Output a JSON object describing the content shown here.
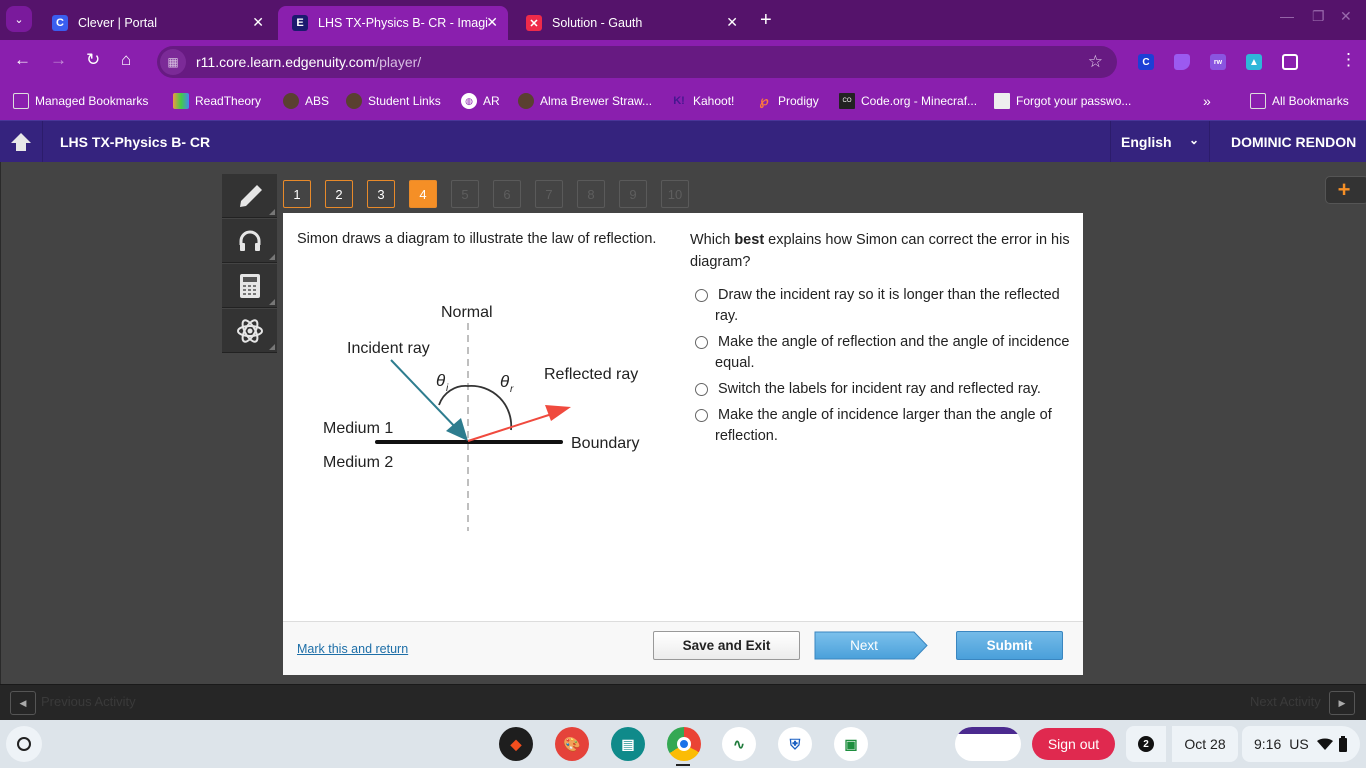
{
  "browser": {
    "tabs": [
      {
        "title": "Clever | Portal",
        "icon": "clever-icon",
        "active": false
      },
      {
        "title": "LHS TX-Physics B- CR - Imagine",
        "icon": "edgenuity-icon",
        "active": true
      },
      {
        "title": "Solution - Gauth",
        "icon": "gauth-icon",
        "active": false
      }
    ],
    "url_host": "r11.core.learn.edgenuity.com",
    "url_path": "/player/",
    "bookmarks": [
      {
        "label": "Managed Bookmarks",
        "icon": "folder-managed-icon"
      },
      {
        "label": "ReadTheory",
        "icon": "readtheory-icon"
      },
      {
        "label": "ABS",
        "icon": "school-seal-icon"
      },
      {
        "label": "Student Links",
        "icon": "school-seal-icon"
      },
      {
        "label": "AR",
        "icon": "globe-icon"
      },
      {
        "label": "Alma Brewer Straw...",
        "icon": "school-seal-icon"
      },
      {
        "label": "Kahoot!",
        "icon": "kahoot-icon"
      },
      {
        "label": "Prodigy",
        "icon": "prodigy-icon"
      },
      {
        "label": "Code.org - Minecraf...",
        "icon": "codeorg-icon"
      },
      {
        "label": "Forgot your passwo...",
        "icon": "page-icon"
      }
    ],
    "all_bookmarks_label": "All Bookmarks"
  },
  "app": {
    "course_title": "LHS TX-Physics B- CR",
    "language": "English",
    "user_name": "DOMINIC RENDON",
    "question_numbers": [
      {
        "n": "1",
        "state": "visited"
      },
      {
        "n": "2",
        "state": "visited"
      },
      {
        "n": "3",
        "state": "visited"
      },
      {
        "n": "4",
        "state": "current"
      },
      {
        "n": "5",
        "state": "locked"
      },
      {
        "n": "6",
        "state": "locked"
      },
      {
        "n": "7",
        "state": "locked"
      },
      {
        "n": "8",
        "state": "locked"
      },
      {
        "n": "9",
        "state": "locked"
      },
      {
        "n": "10",
        "state": "locked"
      }
    ],
    "stem": "Simon draws a diagram to illustrate the law of reflection.",
    "diagram": {
      "normal_label": "Normal",
      "incident_label": "Incident ray",
      "reflected_label": "Reflected ray",
      "medium1_label": "Medium 1",
      "medium2_label": "Medium 2",
      "boundary_label": "Boundary",
      "theta_i": "θ",
      "theta_i_sub": "i",
      "theta_r": "θ",
      "theta_r_sub": "r",
      "incident_color": "#2e7d8f",
      "reflected_color": "#f04a3e"
    },
    "question_pre": "Which ",
    "question_bold": "best",
    "question_post": " explains how Simon can correct the error in his diagram?",
    "options": [
      "Draw the incident ray so it is longer than the reflected ray.",
      "Make the angle of reflection and the angle of incidence equal.",
      "Switch the labels for incident ray and reflected ray.",
      "Make the angle of incidence larger than the angle of reflection."
    ],
    "mark_link": "Mark this and return",
    "save_exit": "Save and Exit",
    "next": "Next",
    "submit": "Submit",
    "prev_activity": "Previous Activity",
    "next_activity": "Next Activity"
  },
  "shelf": {
    "signout": "Sign out",
    "notifications": "2",
    "date": "Oct 28",
    "time": "9:16",
    "locale": "US"
  }
}
